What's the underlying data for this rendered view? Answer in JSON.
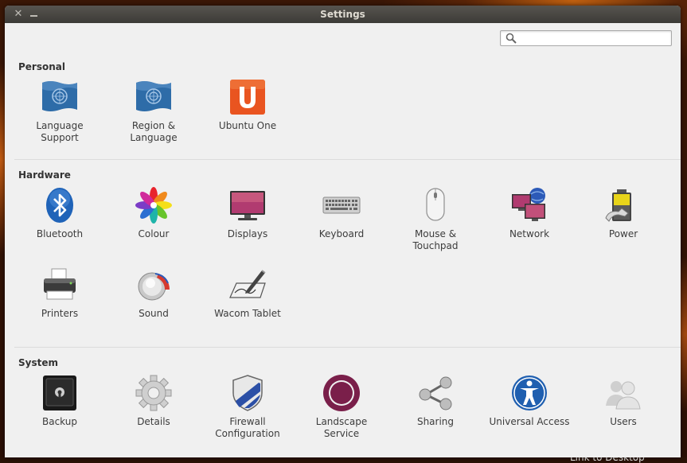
{
  "window": {
    "title": "Settings",
    "close_icon": "close-icon",
    "minimize_icon": "minimize-icon"
  },
  "search": {
    "value": "",
    "placeholder": ""
  },
  "sections": {
    "personal": {
      "title": "Personal",
      "items": [
        {
          "label": "Language\nSupport",
          "icon": "language-flag-icon"
        },
        {
          "label": "Region &\nLanguage",
          "icon": "region-flag-icon"
        },
        {
          "label": "Ubuntu One",
          "icon": "ubuntu-one-icon"
        }
      ]
    },
    "hardware": {
      "title": "Hardware",
      "items": [
        {
          "label": "Bluetooth",
          "icon": "bluetooth-icon"
        },
        {
          "label": "Colour",
          "icon": "colour-icon"
        },
        {
          "label": "Displays",
          "icon": "display-icon"
        },
        {
          "label": "Keyboard",
          "icon": "keyboard-icon"
        },
        {
          "label": "Mouse &\nTouchpad",
          "icon": "mouse-icon"
        },
        {
          "label": "Network",
          "icon": "network-icon"
        },
        {
          "label": "Power",
          "icon": "power-icon"
        },
        {
          "label": "Printers",
          "icon": "printer-icon"
        },
        {
          "label": "Sound",
          "icon": "sound-icon"
        },
        {
          "label": "Wacom Tablet",
          "icon": "wacom-tablet-icon"
        }
      ]
    },
    "system": {
      "title": "System",
      "items": [
        {
          "label": "Backup",
          "icon": "backup-safe-icon"
        },
        {
          "label": "Details",
          "icon": "details-gear-icon"
        },
        {
          "label": "Firewall\nConfiguration",
          "icon": "firewall-shield-icon"
        },
        {
          "label": "Landscape\nService",
          "icon": "landscape-icon"
        },
        {
          "label": "Sharing",
          "icon": "sharing-icon"
        },
        {
          "label": "Universal Access",
          "icon": "universal-access-icon"
        },
        {
          "label": "Users",
          "icon": "users-icon"
        }
      ]
    }
  },
  "desktop": {
    "bottom_text": "Link to Desktop"
  }
}
